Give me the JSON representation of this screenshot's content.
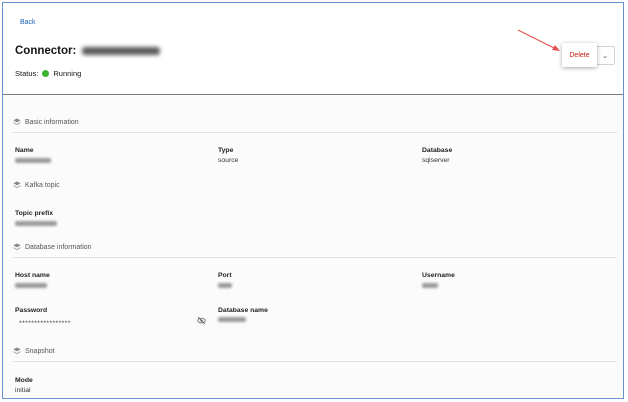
{
  "header": {
    "back_label": "Back",
    "title_prefix": "Connector:",
    "status_label": "Status:",
    "status_value": "Running",
    "status_color": "#3cb52f"
  },
  "actions": {
    "delete_label": "Delete",
    "dropdown_icon": "chevron-down-icon"
  },
  "sections": {
    "basic": {
      "title": "Basic information",
      "name_label": "Name",
      "type_label": "Type",
      "type_value": "source",
      "database_label": "Database",
      "database_value": "sqlserver"
    },
    "kafka": {
      "title": "Kafka topic",
      "topic_prefix_label": "Topic prefix"
    },
    "database": {
      "title": "Database information",
      "host_label": "Host name",
      "port_label": "Port",
      "username_label": "Username",
      "password_label": "Password",
      "password_value": "*****************",
      "dbname_label": "Database name"
    },
    "snapshot": {
      "title": "Snapshot",
      "mode_label": "Mode",
      "mode_value": "initial"
    }
  }
}
